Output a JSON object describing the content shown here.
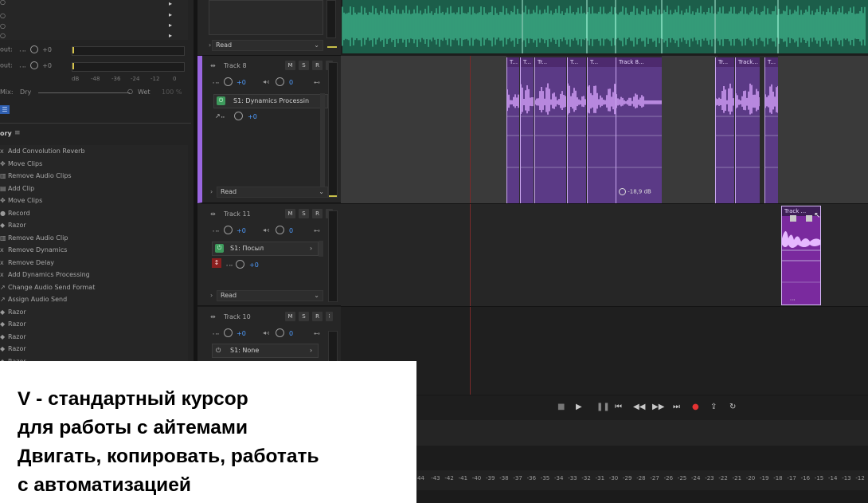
{
  "left_panel": {
    "io_rows": [
      {
        "label": "out:",
        "value": "+0"
      },
      {
        "label": "out:",
        "value": "+0"
      }
    ],
    "db_scale": [
      "dB",
      "-48",
      "-36",
      "-24",
      "-12",
      "0"
    ],
    "mix": {
      "dry": "Dry",
      "wet": "Wet",
      "percent": "100 %"
    },
    "mix_label": "Mix:"
  },
  "history": {
    "title": "ory",
    "items": [
      "Add Convolution Reverb",
      "Move Clips",
      "Remove Audio Clips",
      "Add Clip",
      "Move Clips",
      "Record",
      "Razor",
      "Remove Audio Clip",
      "Remove Dynamics",
      "Remove Delay",
      "Add Dynamics Processing",
      "Change Audio Send Format",
      "Assign Audio Send",
      "Razor",
      "Razor",
      "Razor",
      "Razor",
      "Razor"
    ]
  },
  "tracks": [
    {
      "name": "Track 8",
      "m": "M",
      "s": "S",
      "r": "R",
      "vol": "+0",
      "pan": "0",
      "fx": "S1: Dynamics Processin",
      "send": "+0",
      "mode": "Read"
    },
    {
      "name": "Track 11",
      "m": "M",
      "s": "S",
      "r": "R",
      "vol": "+0",
      "pan": "0",
      "fx": "S1: Посыл",
      "send": "+0",
      "mode": "Read"
    },
    {
      "name": "Track 10",
      "m": "M",
      "s": "S",
      "r": "R",
      "vol": "+0",
      "pan": "0",
      "fx": "S1: None"
    }
  ],
  "top_track": {
    "mode": "Read"
  },
  "clips": {
    "track8_titles": [
      "T...",
      "T...",
      "Tr...",
      "T...",
      "T...",
      "Track 8...",
      "Tr...",
      "Track...",
      "T..."
    ],
    "track8_db": "-18,9 dB",
    "track11_title": "Track ..."
  },
  "caption": {
    "lines": [
      "V - стандартный курсор",
      "для работы с айтемами",
      "Двигать, копировать, работать",
      "с автоматизацией"
    ]
  },
  "ruler": {
    "labels": [
      "44",
      "-43",
      "-42",
      "-41",
      "-40",
      "-39",
      "-38",
      "-37",
      "-36",
      "-35",
      "-34",
      "-33",
      "-32",
      "-31",
      "-30",
      "-29",
      "-28",
      "-27",
      "-26",
      "-25",
      "-24",
      "-23",
      "-22",
      "-21",
      "-20",
      "-19",
      "-18",
      "-17",
      "-16",
      "-15",
      "-14",
      "-13",
      "-12"
    ]
  },
  "colors": {
    "waveform_green": "#2f9a78",
    "clip_purple": "#5b3a86",
    "waveform_light_purple": "#cf9cf4",
    "record_red": "#e53333",
    "track_accent": "#9a66e0"
  }
}
